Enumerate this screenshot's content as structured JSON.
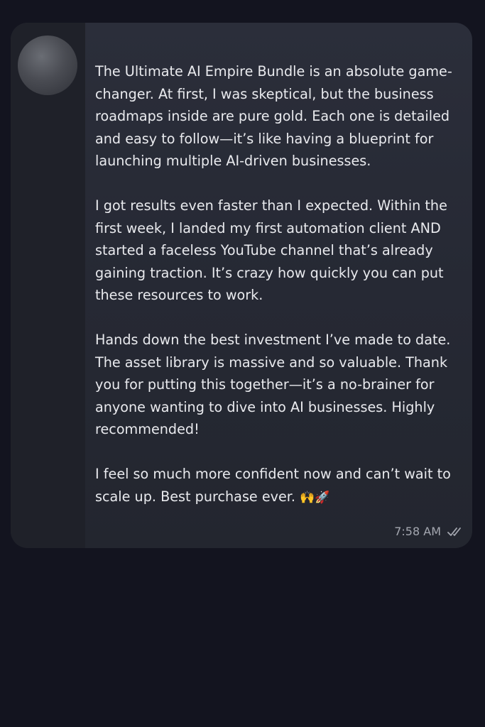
{
  "message": {
    "paragraphs": [
      "The Ultimate AI Empire Bundle is an absolute game-changer. At first, I was skeptical, but the business roadmaps inside are pure gold. Each one is detailed and easy to follow—it’s like having a blueprint for launching multiple AI-driven businesses.",
      "I got results even faster than I expected. Within the first week, I landed my first automation client AND started a faceless YouTube channel that’s already gaining traction. It’s crazy how quickly you can put these resources to work.",
      "Hands down the best investment I’ve made to date. The asset library is massive and so valuable. Thank you for putting this together—it’s a no-brainer for anyone wanting to dive into AI businesses. Highly recommended!",
      "I feel so much more confident now and can’t wait to scale up. Best purchase ever."
    ],
    "emojis": "🙌🚀",
    "time": "7:58 AM",
    "status_icon": "double-check-icon"
  },
  "colors": {
    "background": "#13141f",
    "bubble": "#282b36",
    "text": "#e9eaee",
    "meta_text": "#a4a7b0"
  }
}
